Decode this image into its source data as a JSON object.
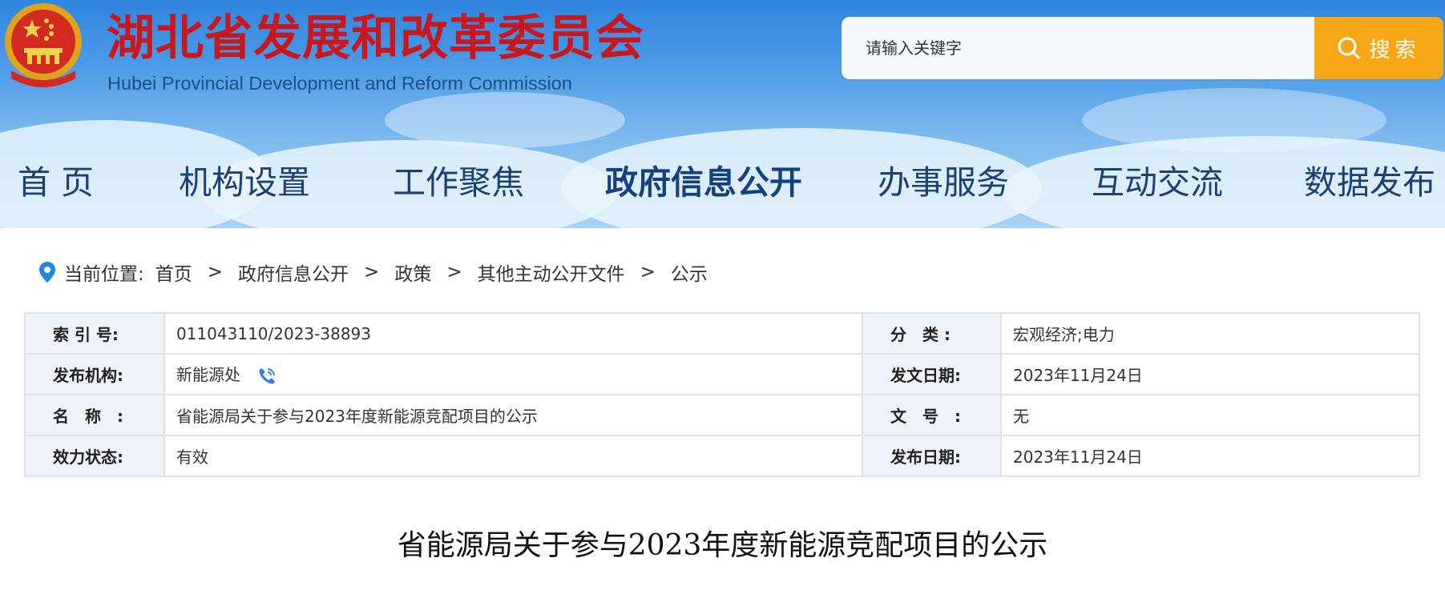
{
  "header": {
    "brand_cn": "湖北省发展和改革委员会",
    "brand_en": "Hubei Provincial Development and Reform Commission",
    "emblem_icon": "national-emblem-icon",
    "brand_red": "#c8171d",
    "brand_blue": "#1a4f8c"
  },
  "search": {
    "placeholder": "请输入关键字",
    "button_label": "搜索",
    "button_icon": "search-icon",
    "button_color": "#f5a716"
  },
  "nav": {
    "items": [
      {
        "label": "首 页"
      },
      {
        "label": "机构设置"
      },
      {
        "label": "工作聚焦"
      },
      {
        "label": "政府信息公开",
        "active": true
      },
      {
        "label": "办事服务"
      },
      {
        "label": "互动交流"
      },
      {
        "label": "数据发布"
      }
    ],
    "text_color": "#1e3f73"
  },
  "breadcrumb": {
    "icon": "location-pin-icon",
    "prefix": "当前位置:",
    "separator": ">",
    "items": [
      "首页",
      "政府信息公开",
      "政策",
      "其他主动公开文件",
      "公示"
    ]
  },
  "info": {
    "index_label": "索 引 号:",
    "index_value": "011043110/2023-38893",
    "category_label": "分　类 :",
    "category_value": "宏观经济;电力",
    "publisher_label": "发布机构:",
    "publisher_value": "新能源处",
    "publisher_icon": "phone-icon",
    "issue_date_label": "发文日期:",
    "issue_date_value": "2023年11月24日",
    "name_label": "名　称　:",
    "name_value": "省能源局关于参与2023年度新能源竞配项目的公示",
    "doc_number_label": "文　号　:",
    "doc_number_value": "无",
    "status_label": "效力状态:",
    "status_value": "有效",
    "publish_date_label": "发布日期:",
    "publish_date_value": "2023年11月24日"
  },
  "document": {
    "title": "省能源局关于参与2023年度新能源竞配项目的公示"
  }
}
